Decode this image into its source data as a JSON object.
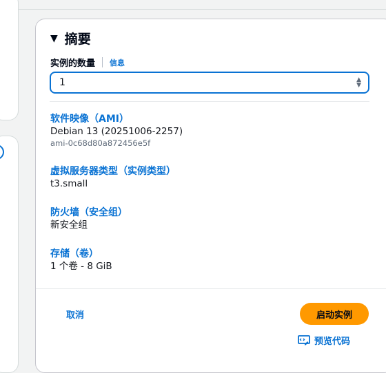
{
  "summary": {
    "title": "摘要",
    "quantity_label": "实例的数量",
    "info_link": "信息",
    "quantity_value": "1",
    "sections": [
      {
        "title": "软件映像（AMI）",
        "value": "Debian 13 (20251006-2257)",
        "sub": "ami-0c68d80a872456e5f"
      },
      {
        "title": "虚拟服务器类型（实例类型）",
        "value": "t3.small"
      },
      {
        "title": "防火墙（安全组）",
        "value": "新安全组"
      },
      {
        "title": "存储（卷）",
        "value": "1 个卷 - 8 GiB"
      }
    ],
    "cancel_label": "取消",
    "launch_label": "启动实例",
    "preview_code_label": "预览代码"
  },
  "colors": {
    "accent": "#0972d3",
    "primary_button": "#ff9900"
  }
}
